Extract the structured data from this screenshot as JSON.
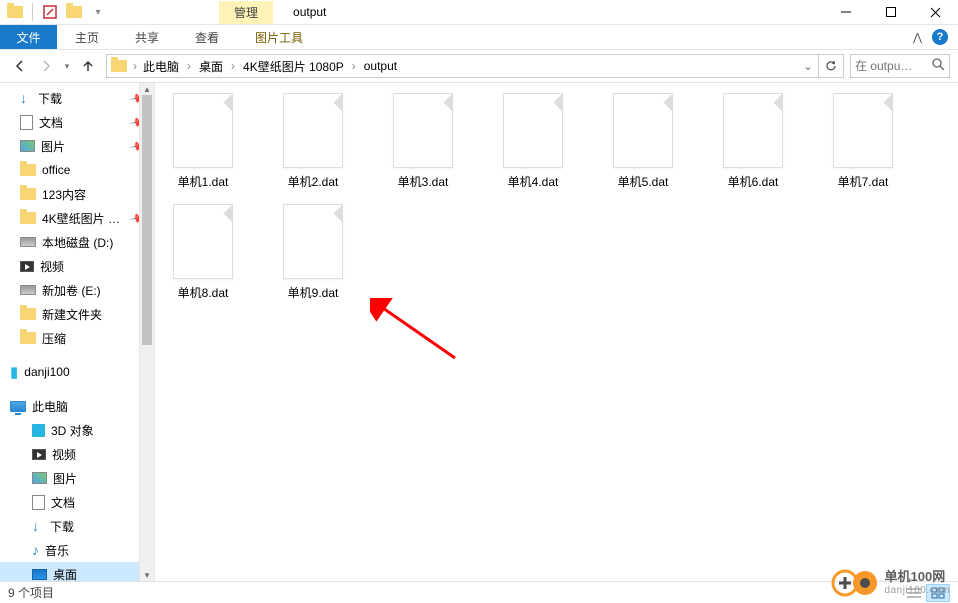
{
  "window": {
    "manage_label": "管理",
    "picture_tools": "图片工具",
    "title": "output"
  },
  "tabs": {
    "file": "文件",
    "home": "主页",
    "share": "共享",
    "view": "查看"
  },
  "breadcrumb": {
    "pc": "此电脑",
    "desktop": "桌面",
    "folder1": "4K壁纸图片 1080P",
    "folder2": "output"
  },
  "search": {
    "placeholder": "在 outpu…"
  },
  "sidebar": {
    "downloads": "下载",
    "documents": "文档",
    "pictures": "图片",
    "office": "office",
    "c123": "123内容",
    "wall4k": "4K壁纸图片 …",
    "drive_d": "本地磁盘 (D:)",
    "video": "视频",
    "drive_e": "新加卷 (E:)",
    "newfolder": "新建文件夹",
    "zip": "压缩",
    "danji": "danji100",
    "thispc": "此电脑",
    "obj3d": "3D 对象",
    "video2": "视频",
    "pictures2": "图片",
    "documents2": "文档",
    "downloads2": "下载",
    "music": "音乐",
    "desktop": "桌面"
  },
  "files": [
    {
      "name": "单机1.dat"
    },
    {
      "name": "单机2.dat"
    },
    {
      "name": "单机3.dat"
    },
    {
      "name": "单机4.dat"
    },
    {
      "name": "单机5.dat"
    },
    {
      "name": "单机6.dat"
    },
    {
      "name": "单机7.dat"
    },
    {
      "name": "单机8.dat"
    },
    {
      "name": "单机9.dat"
    }
  ],
  "status": {
    "count": "9 个项目"
  },
  "watermark": {
    "title": "单机100网",
    "sub": "danji100.com"
  }
}
